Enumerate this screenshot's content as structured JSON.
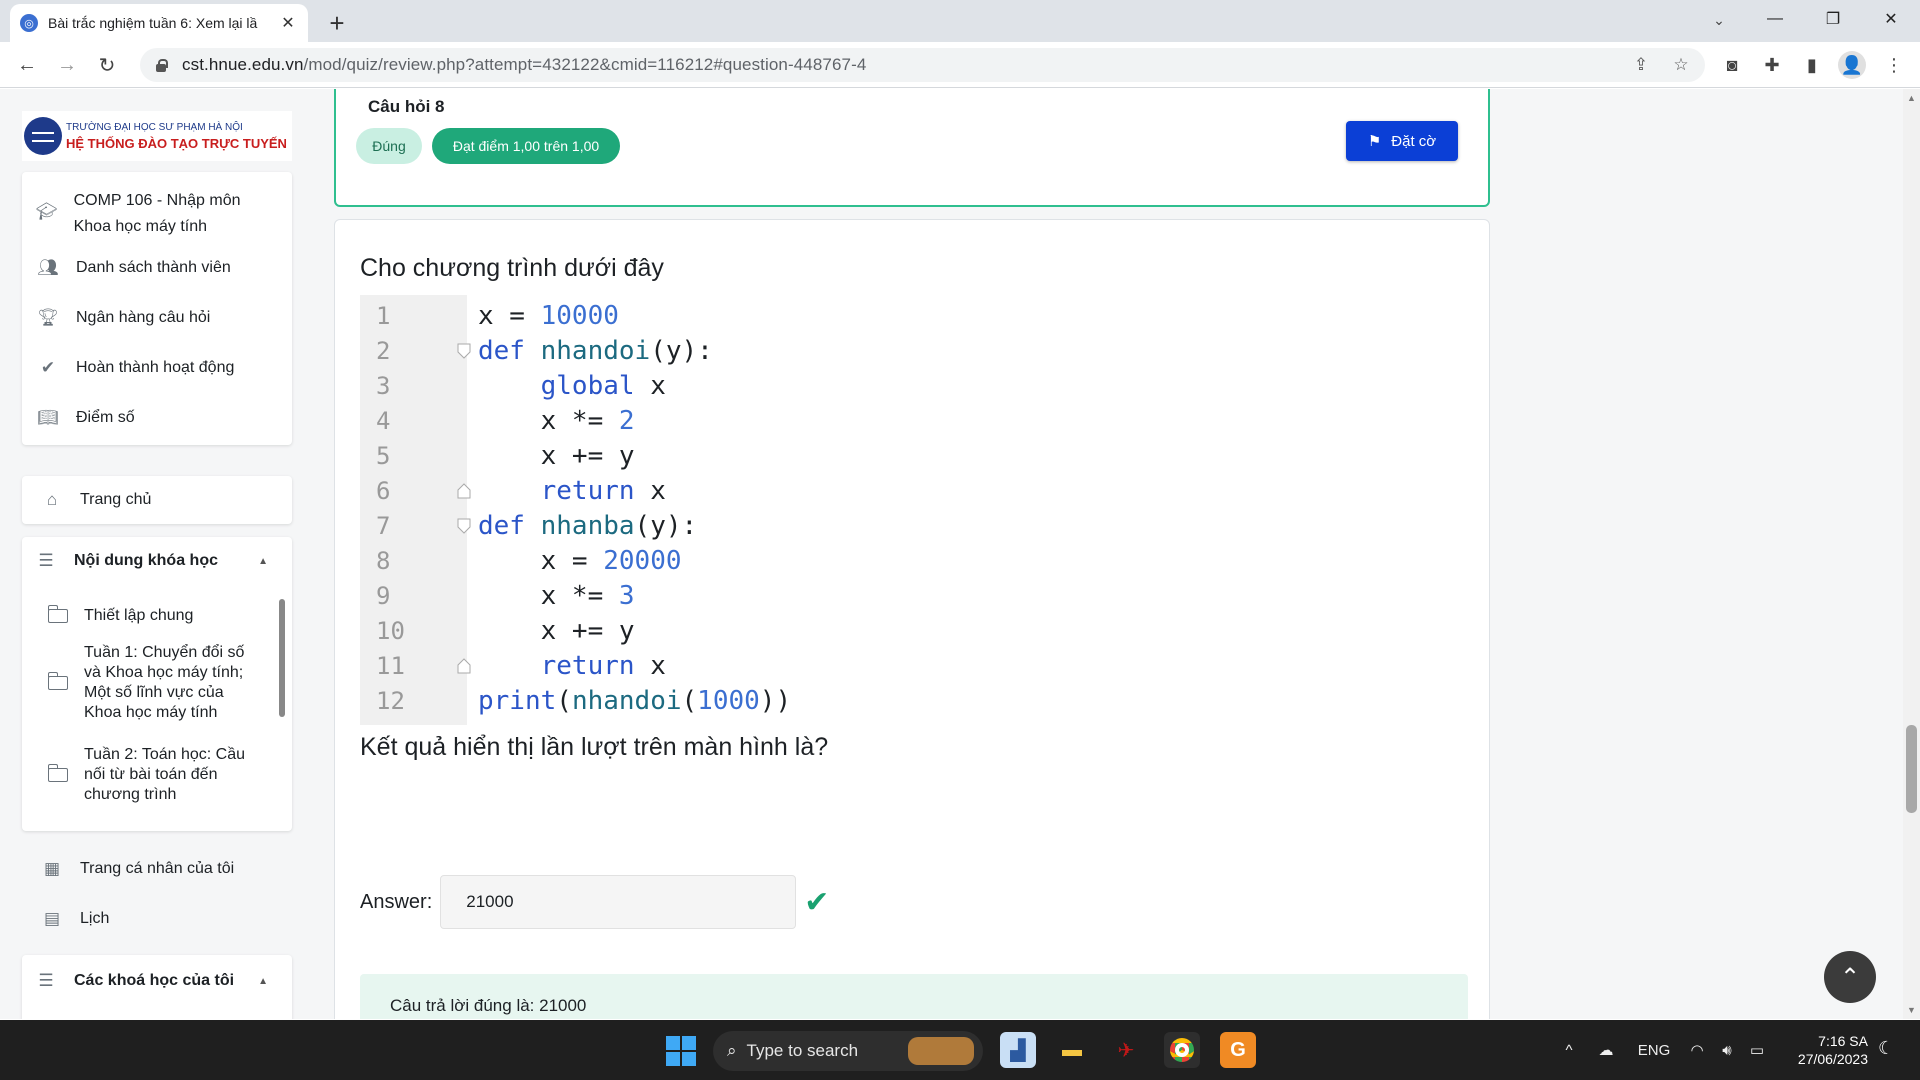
{
  "browser": {
    "tab_title": "Bài trắc nghiệm tuần 6: Xem lại lầ",
    "url_host": "cst.hnue.edu.vn",
    "url_path": "/mod/quiz/review.php?attempt=432122&cmid=116212#question-448767-4"
  },
  "logo": {
    "line1": "TRƯỜNG ĐẠI HỌC SƯ PHẠM HÀ NỘI",
    "line2": "HỆ THỐNG ĐÀO TẠO TRỰC TUYẾN"
  },
  "course_nav": {
    "course_title": "COMP 106 - Nhập môn Khoa học máy tính",
    "items": [
      "Danh sách thành viên",
      "Ngân hàng câu hỏi",
      "Hoàn thành hoạt động",
      "Điểm số"
    ]
  },
  "site_nav": {
    "home": "Trang chủ",
    "course_content": "Nội dung khóa học",
    "sections": [
      "Thiết lập chung",
      "Tuần 1: Chuyển đổi số và Khoa học máy tính; Một số lĩnh vực của Khoa học máy tính",
      "Tuần 2: Toán học: Cầu nối từ bài toán đến chương trình"
    ],
    "dashboard": "Trang cá nhân của tôi",
    "calendar": "Lịch",
    "my_courses": "Các khoá học của tôi"
  },
  "question": {
    "number": "Câu hỏi 8",
    "status": "Đúng",
    "grade": "Đạt điểm 1,00 trên 1,00",
    "flag_label": "Đặt cờ",
    "intro": "Cho chương trình dưới đây",
    "code_lines": [
      "x = 10000",
      "def nhandoi(y):",
      "    global x",
      "    x *= 2",
      "    x += y",
      "    return x",
      "def nhanba(y):",
      "    x = 20000",
      "    x *= 3",
      "    x += y",
      "    return x",
      "print(nhandoi(1000))"
    ],
    "prompt": "Kết quả hiển thị lần lượt trên màn hình là?",
    "answer_label": "Answer:",
    "answer_value": "21000",
    "feedback": "Câu trả lời đúng là: 21000"
  },
  "taskbar": {
    "search_placeholder": "Type to search",
    "lang": "ENG",
    "time": "7:16 SA",
    "date": "27/06/2023"
  },
  "colors": {
    "accent": "#0b3fd6",
    "success": "#1fa87a",
    "success_light": "#c9efe2",
    "feedback_bg": "#e7f6f0"
  }
}
